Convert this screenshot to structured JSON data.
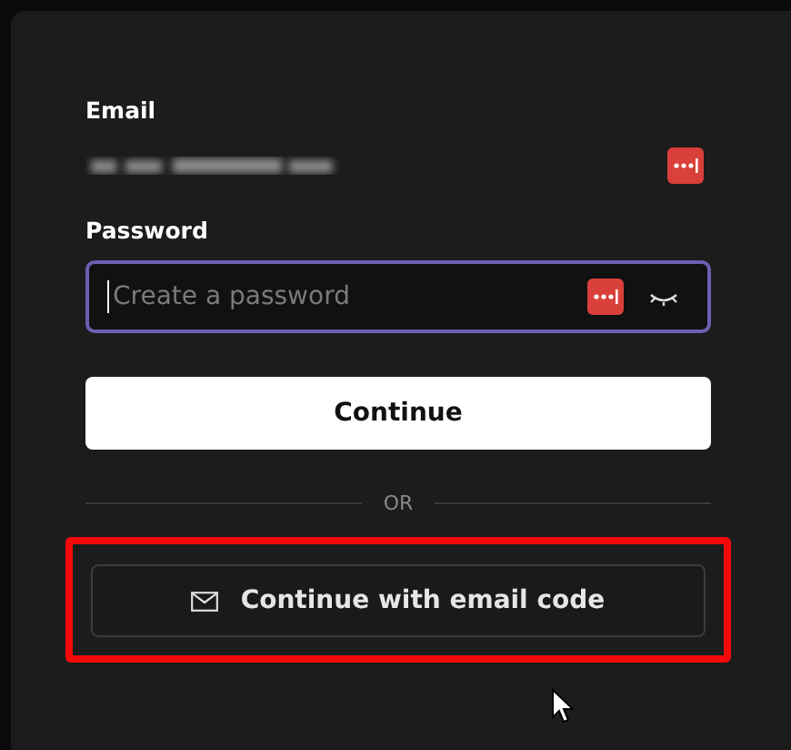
{
  "email": {
    "label": "Email"
  },
  "password": {
    "label": "Password",
    "placeholder": "Create a password",
    "focused": true
  },
  "primary_button": {
    "label": "Continue"
  },
  "divider": {
    "text": "OR"
  },
  "secondary_button": {
    "label": "Continue with email code",
    "highlighted": true
  }
}
